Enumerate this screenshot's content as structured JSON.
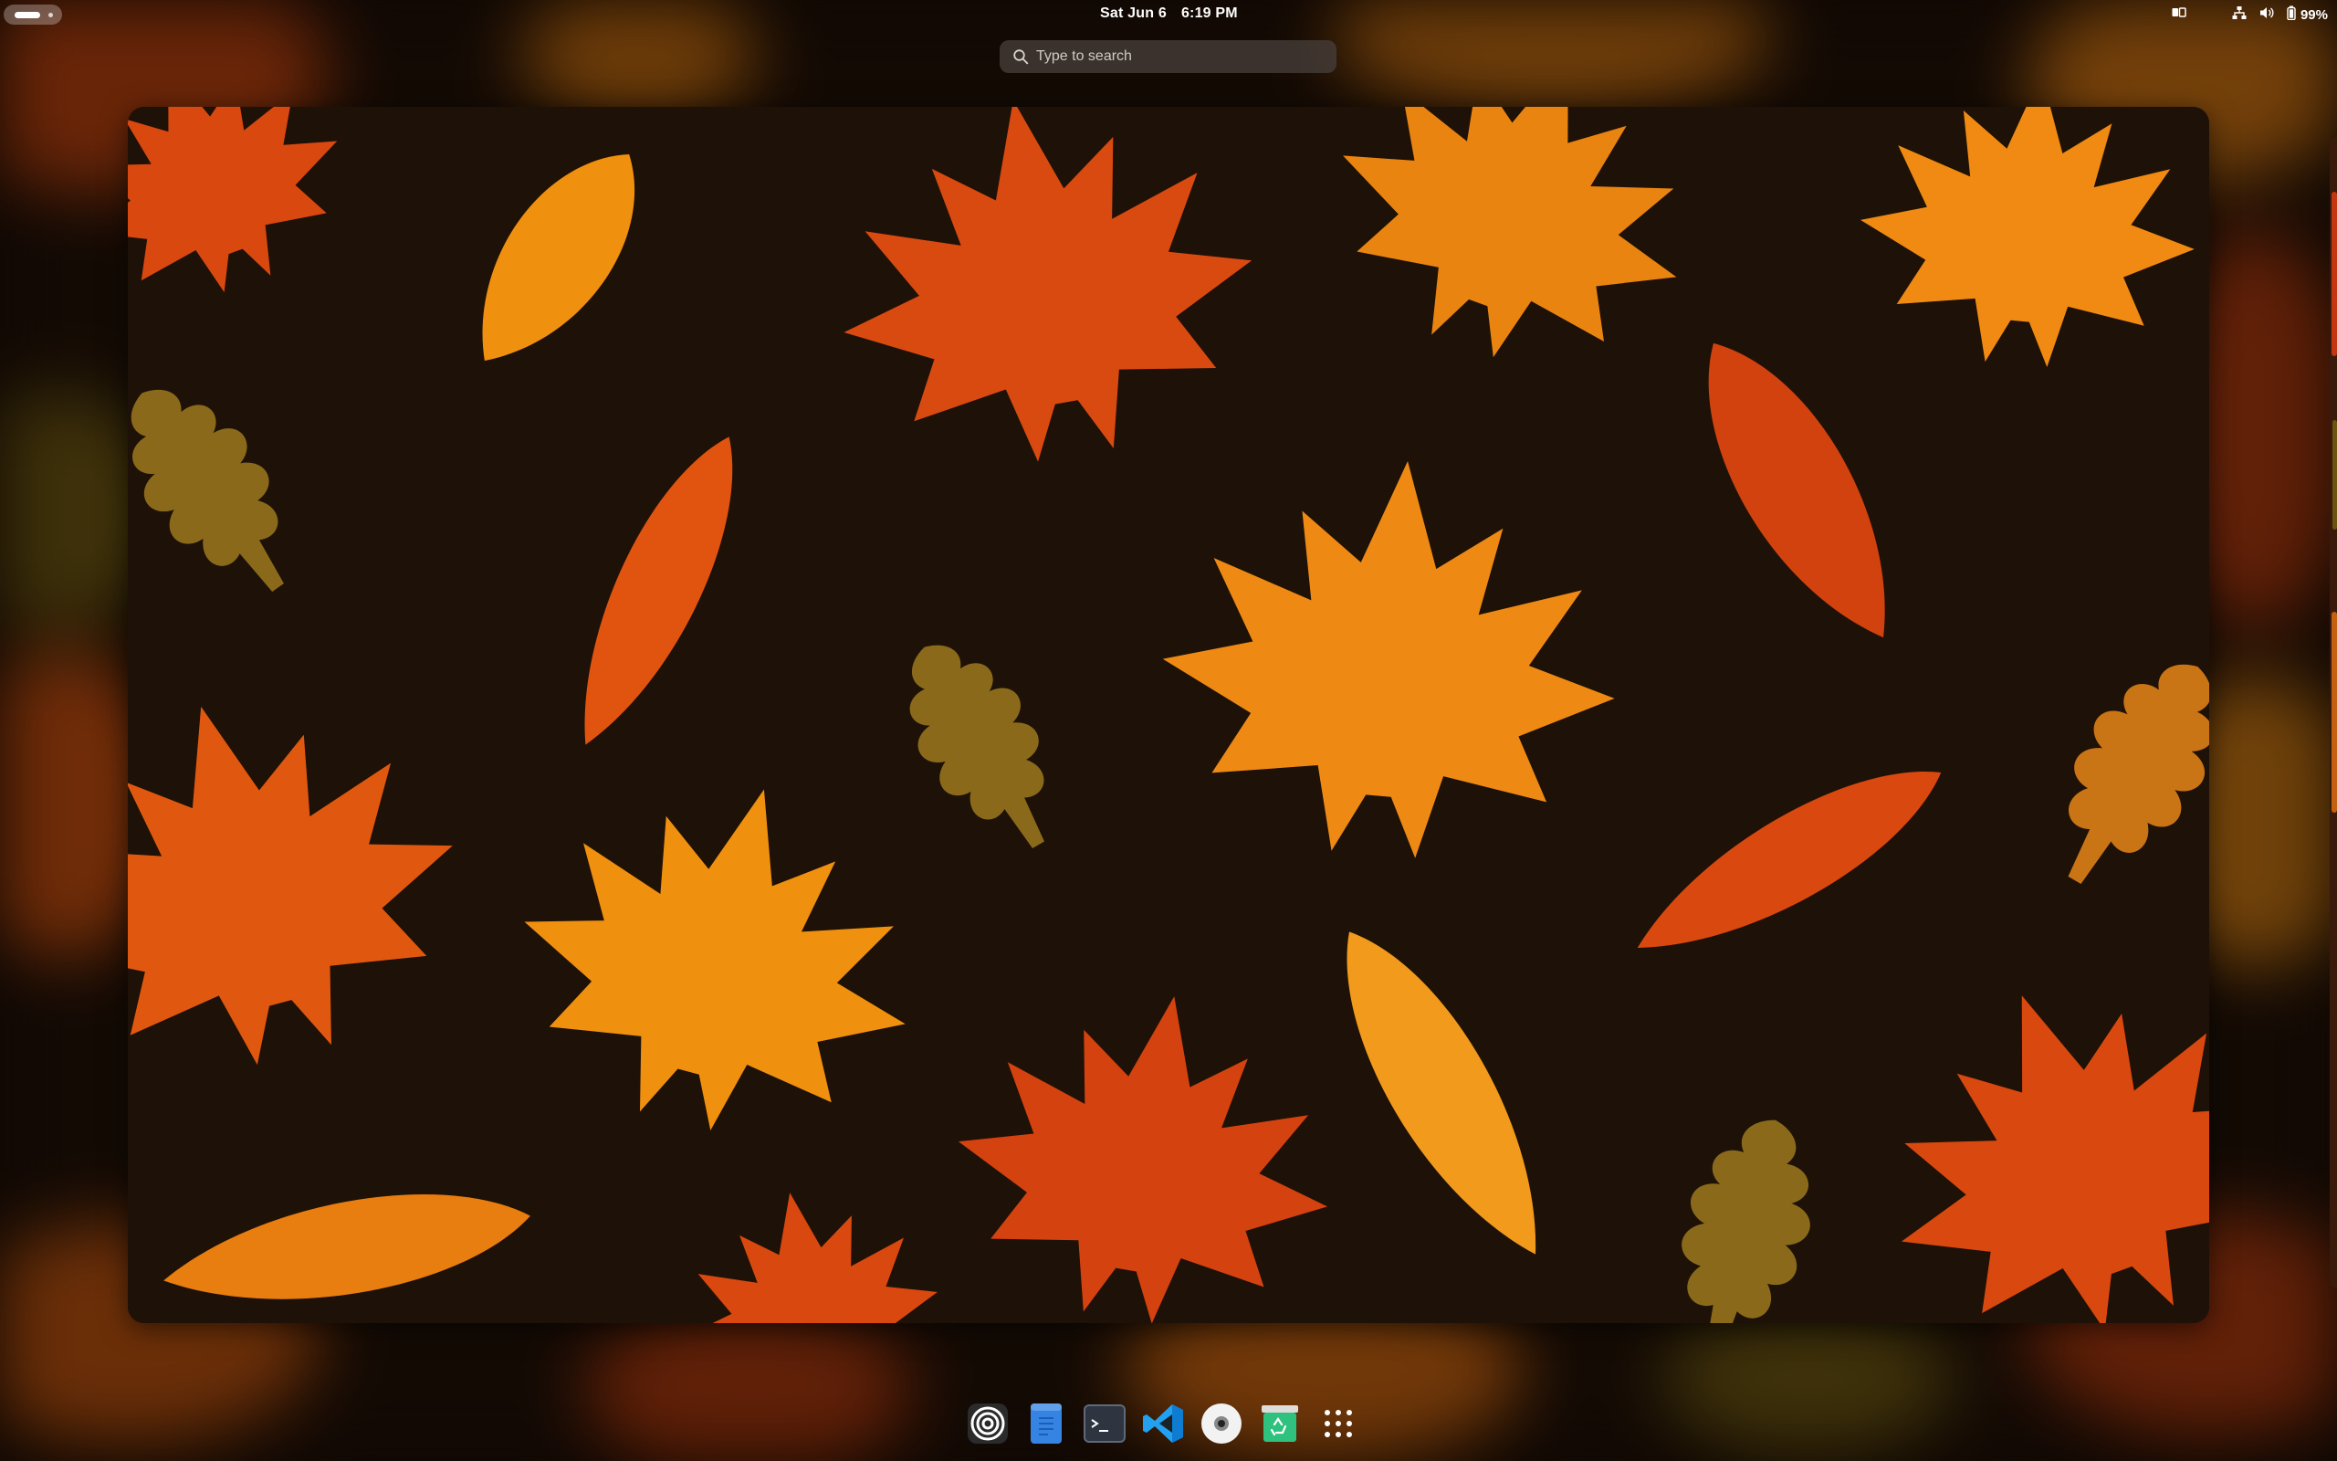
{
  "topbar": {
    "date": "Sat Jun 6",
    "time": "6:19 PM",
    "battery": "99%",
    "icons": [
      "activities-indicator",
      "workspace-switcher-icon",
      "network-icon",
      "volume-icon",
      "battery-icon"
    ]
  },
  "search": {
    "placeholder": "Type to search",
    "value": ""
  },
  "dash": {
    "apps": [
      {
        "name": "podman-desktop-icon"
      },
      {
        "name": "text-editor-icon"
      },
      {
        "name": "terminal-icon"
      },
      {
        "name": "vscode-icon"
      },
      {
        "name": "disc-icon"
      },
      {
        "name": "software-icon"
      }
    ],
    "app_grid": "app-grid-icon"
  },
  "colors": {
    "accent": "#3584e4",
    "vscode": "#22a1f0",
    "software_green": "#2ec27e",
    "wallpaper_bg": "#1e1107",
    "leaf_red": "#d9480f",
    "leaf_orange": "#e87d0d",
    "leaf_amber": "#f29a1c",
    "leaf_olive": "#8a6a1a"
  }
}
